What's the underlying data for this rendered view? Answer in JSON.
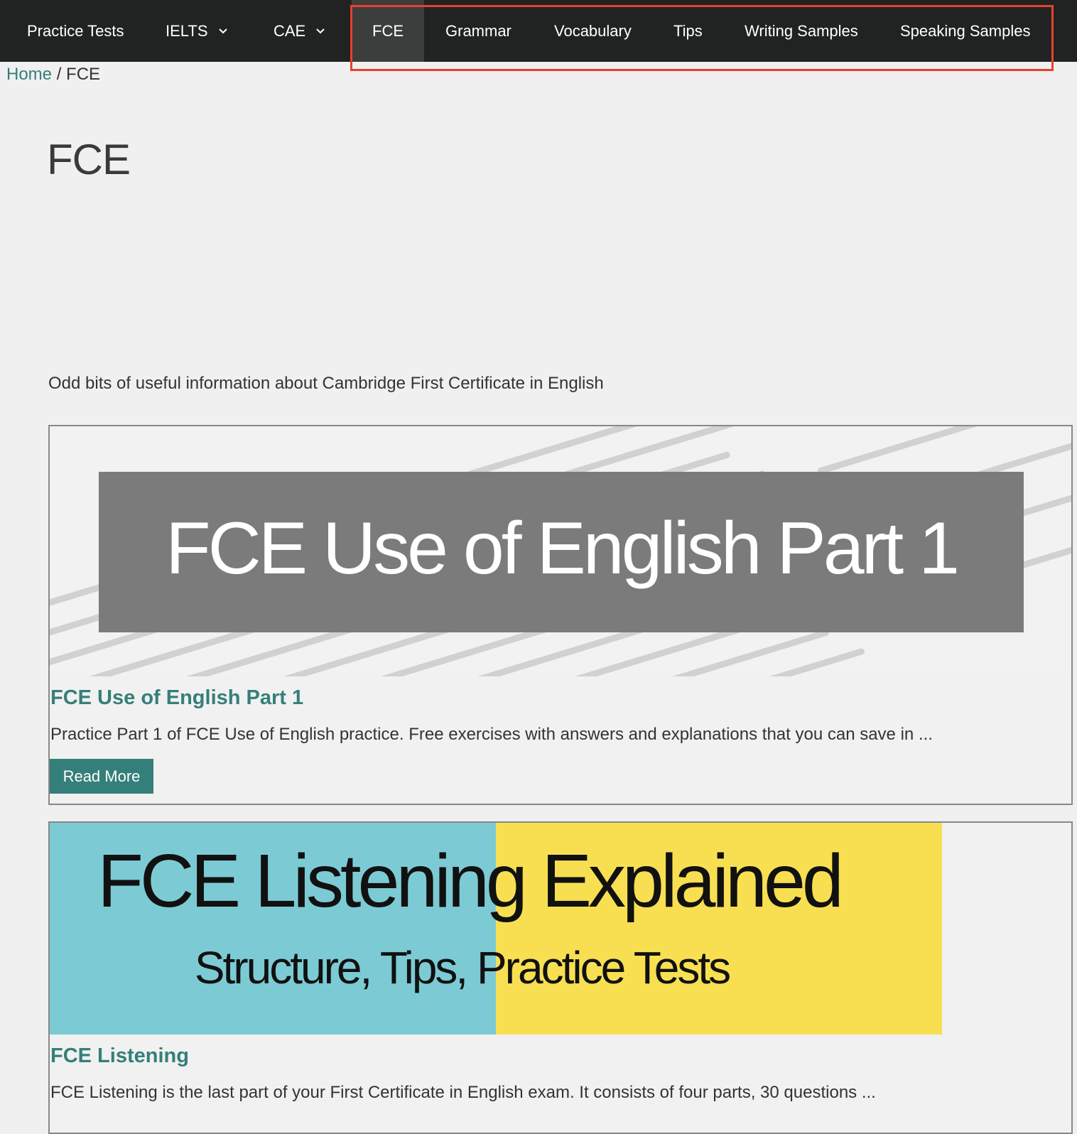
{
  "nav": {
    "items": [
      {
        "label": "Practice Tests"
      },
      {
        "label": "IELTS"
      },
      {
        "label": "CAE"
      },
      {
        "label": "FCE"
      },
      {
        "label": "Grammar"
      },
      {
        "label": "Vocabulary"
      },
      {
        "label": "Tips"
      },
      {
        "label": "Writing Samples"
      },
      {
        "label": "Speaking Samples"
      }
    ],
    "active": "FCE"
  },
  "breadcrumb": {
    "home": "Home",
    "separator": "/",
    "current": "FCE"
  },
  "page": {
    "title": "FCE",
    "intro": "Odd bits of useful information about Cambridge First Certificate in English"
  },
  "articles": [
    {
      "image_text": "FCE Use of English Part 1",
      "title": "FCE Use of English Part 1",
      "excerpt": "Practice Part 1 of FCE Use of English practice. Free exercises with answers and explanations that you can save in ...",
      "read_more": "Read More"
    },
    {
      "image_title": "FCE Listening Explained",
      "image_subtitle": "Structure, Tips, Practice Tests",
      "title": "FCE Listening",
      "excerpt": "FCE Listening is the last part of your First Certificate in English exam. It consists of four parts, 30 questions ..."
    }
  ],
  "colors": {
    "navbar": "#212323",
    "accent": "#357f7a",
    "highlight": "#e8402c",
    "cyan": "#7ccbd4",
    "yellow": "#f8df52"
  }
}
